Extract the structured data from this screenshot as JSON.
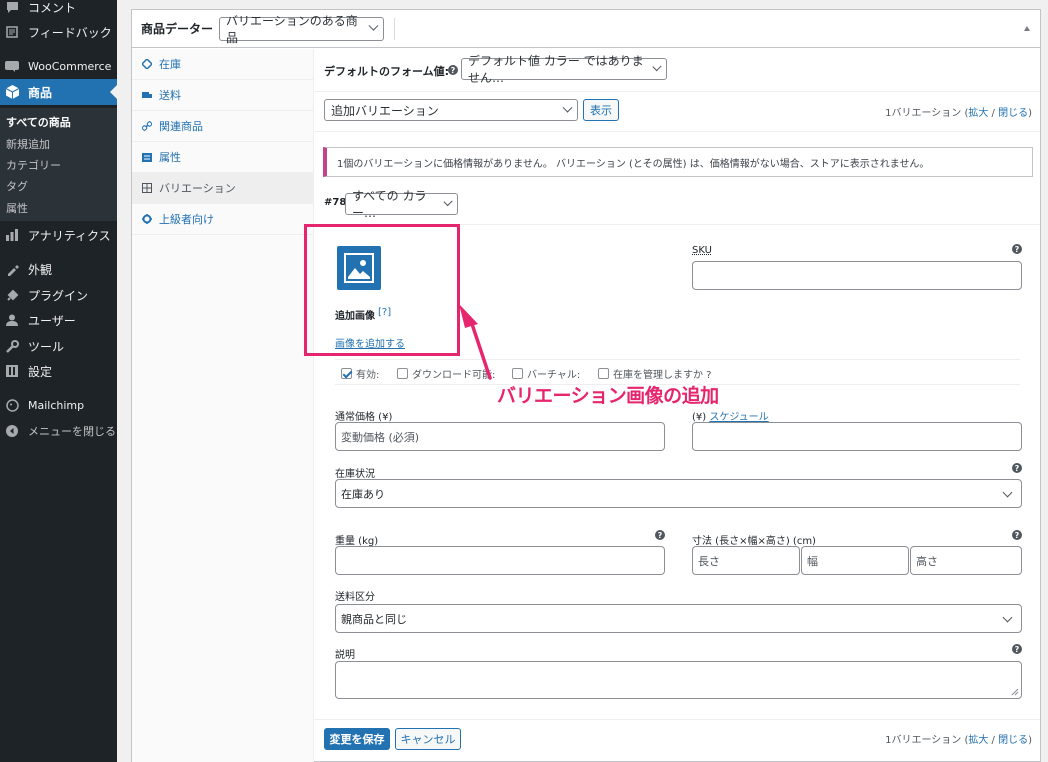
{
  "admin_menu": {
    "items": [
      {
        "label": "コメント",
        "icon": "comment-icon"
      },
      {
        "label": "フィードバック",
        "icon": "feedback-icon"
      },
      {
        "label": "WooCommerce",
        "icon": "woocommerce-icon"
      },
      {
        "label": "商品",
        "icon": "product-icon"
      },
      {
        "label": "アナリティクス",
        "icon": "analytics-icon"
      },
      {
        "label": "外観",
        "icon": "appearance-icon"
      },
      {
        "label": "プラグイン",
        "icon": "plugin-icon"
      },
      {
        "label": "ユーザー",
        "icon": "user-icon"
      },
      {
        "label": "ツール",
        "icon": "tools-icon"
      },
      {
        "label": "設定",
        "icon": "settings-icon"
      },
      {
        "label": "Mailchimp",
        "icon": "mailchimp-icon"
      },
      {
        "label": "メニューを閉じる",
        "icon": "collapse-icon"
      }
    ],
    "submenu": [
      "すべての商品",
      "新規追加",
      "カテゴリー",
      "タグ",
      "属性"
    ]
  },
  "product_data": {
    "title": "商品データー",
    "type_select": "バリエーションのある商品"
  },
  "tabs": [
    {
      "label": "在庫",
      "icon": "inventory-icon"
    },
    {
      "label": "送料",
      "icon": "shipping-icon"
    },
    {
      "label": "関連商品",
      "icon": "link-icon"
    },
    {
      "label": "属性",
      "icon": "attributes-icon"
    },
    {
      "label": "バリエーション",
      "icon": "variations-icon"
    },
    {
      "label": "上級者向け",
      "icon": "advanced-icon"
    }
  ],
  "panel": {
    "default_form_label": "デフォルトのフォーム値:",
    "default_form_select": "デフォルト値 カラー ではありません…",
    "add_variation_select": "追加バリエーション",
    "show_button": "表示",
    "variation_count_top": "1バリエーション (",
    "expand": "拡大",
    "sep": " / ",
    "close": "閉じる",
    "variation_count_end": ")",
    "notice": "1個のバリエーションに価格情報がありません。 バリエーション (とその属性) は、価格情報がない場合、ストアに表示されません。",
    "variation_id": "#78",
    "variation_attr": "すべての カラー…",
    "image_label": "追加画像",
    "image_help": "[?]",
    "add_image_link": "画像を追加する",
    "sku_label": "SKU",
    "checkboxes": [
      {
        "label": "有効:",
        "checked": true
      },
      {
        "label": "ダウンロード可能:",
        "checked": false
      },
      {
        "label": "バーチャル:",
        "checked": false
      },
      {
        "label": "在庫を管理しますか ?",
        "checked": false
      }
    ],
    "regular_price_label": "通常価格 (¥)",
    "regular_price_placeholder": "変動価格 (必須)",
    "sale_price_label_partial": "(¥)",
    "schedule_link": "スケジュール",
    "stock_status_label": "在庫状況",
    "stock_status_value": "在庫あり",
    "weight_label": "重量 (kg)",
    "dimensions_label": "寸法 (長さ×幅×高さ) (cm)",
    "length_placeholder": "長さ",
    "width_placeholder": "幅",
    "height_placeholder": "高さ",
    "shipping_class_label": "送料区分",
    "shipping_class_value": "親商品と同じ",
    "description_label": "説明",
    "save_button": "変更を保存",
    "cancel_button": "キャンセル"
  },
  "annotation": {
    "text": "バリエーション画像の追加",
    "color": "#e5266e"
  },
  "colors": {
    "admin_bg": "#1d2327",
    "accent": "#2271b1",
    "notice_border": "#c2448a"
  }
}
